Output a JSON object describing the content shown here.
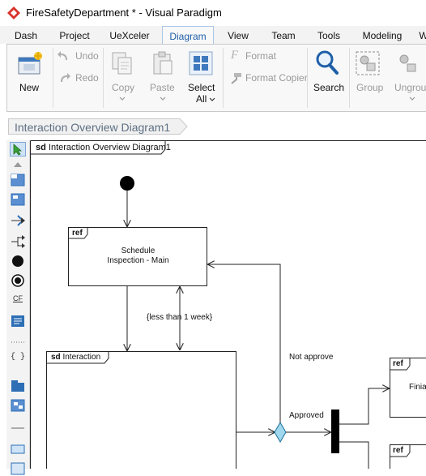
{
  "window": {
    "title": "FireSafetyDepartment * - Visual Paradigm",
    "logo_icon": "visual-paradigm-logo-icon"
  },
  "tabs": [
    {
      "label": "Dash"
    },
    {
      "label": "Project"
    },
    {
      "label": "UeXceler"
    },
    {
      "label": "Diagram",
      "active": true
    },
    {
      "label": "View"
    },
    {
      "label": "Team"
    },
    {
      "label": "Tools"
    },
    {
      "label": "Modeling"
    },
    {
      "label": "W"
    }
  ],
  "ribbon": {
    "new": "New",
    "undo": "Undo",
    "redo": "Redo",
    "copy": "Copy",
    "paste": "Paste",
    "select_all_1": "Select",
    "select_all_2": "All",
    "format": "Format",
    "format_copier": "Format Copier",
    "search": "Search",
    "group": "Group",
    "ungroup": "Ungroup"
  },
  "breadcrumb": {
    "label": "Interaction Overview Diagram1"
  },
  "diagram": {
    "frame": {
      "tag": "sd",
      "name": "Interaction Overview Diagram1"
    },
    "ref_schedule": {
      "tag": "ref",
      "line1": "Schedule",
      "line2": "Inspection - Main"
    },
    "guard_less": "{less than 1 week}",
    "sd_interaction": {
      "tag": "sd",
      "name": "Interaction"
    },
    "guard_not_approve": "Not approve",
    "guard_approved": "Approved",
    "ref_finial": {
      "tag": "ref",
      "text": "Finial"
    },
    "ref_lower": {
      "tag": "ref"
    }
  },
  "colors": {
    "accent": "#1f5fa8",
    "decision": "#9fd8ee",
    "palette_blue": "#2e6fb5"
  }
}
